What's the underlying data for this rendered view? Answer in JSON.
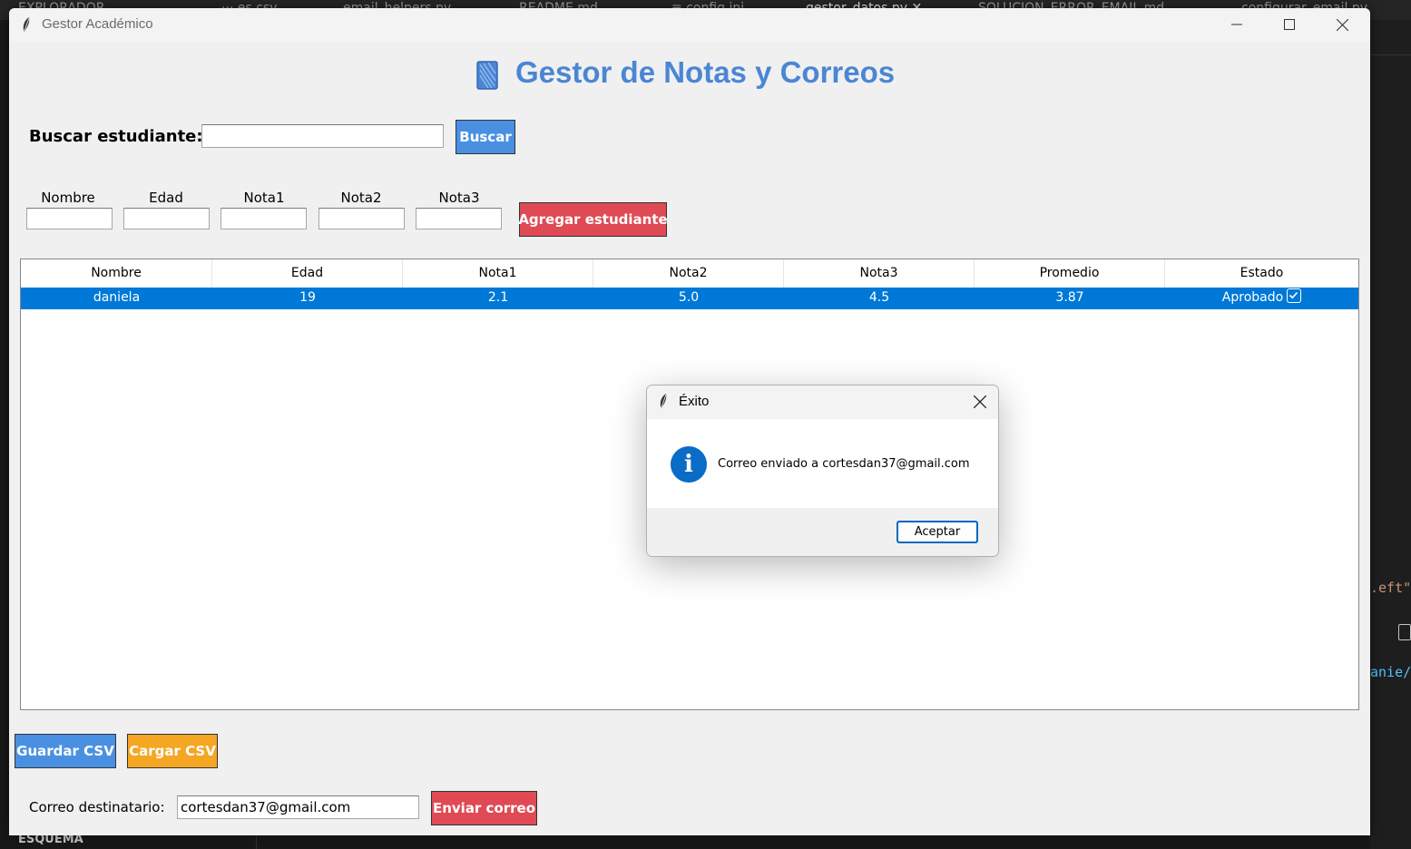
{
  "background_editor": {
    "tabs": [
      {
        "label": "EXPLORADOR",
        "active": false
      },
      {
        "label": "··· es.csv",
        "active": false
      },
      {
        "label": "email_helpers.py",
        "active": false
      },
      {
        "label": "README.md",
        "active": false
      },
      {
        "label": "≡ config.ini",
        "active": false
      },
      {
        "label": "gestor_datos.py ✕",
        "active": true
      },
      {
        "label": "SOLUCION_ERROR_EMAIL.md",
        "active": false
      },
      {
        "label": "configurar_email.py",
        "active": false
      }
    ],
    "code_fragments": [
      ".eft\",",
      "anie/D"
    ],
    "bottom_panel_label": "ESQUEMA"
  },
  "window": {
    "title": "Gestor Académico",
    "icon": "feather-icon"
  },
  "header": {
    "icon": "notebook-icon",
    "title": "Gestor de Notas y Correos"
  },
  "search": {
    "label": "Buscar estudiante:",
    "value": "",
    "button_label": "Buscar"
  },
  "form": {
    "labels": [
      "Nombre",
      "Edad",
      "Nota1",
      "Nota2",
      "Nota3"
    ],
    "add_button_label": "Agregar estudiante"
  },
  "table": {
    "columns": [
      "Nombre",
      "Edad",
      "Nota1",
      "Nota2",
      "Nota3",
      "Promedio",
      "Estado"
    ],
    "rows": [
      {
        "Nombre": "daniela",
        "Edad": "19",
        "Nota1": "2.1",
        "Nota2": "5.0",
        "Nota3": "4.5",
        "Promedio": "3.87",
        "Estado": "Aprobado",
        "selected": true
      }
    ]
  },
  "csv": {
    "save_label": "Guardar CSV",
    "load_label": "Cargar CSV"
  },
  "email": {
    "label": "Correo destinatario:",
    "value": "cortesdan37@gmail.com",
    "send_label": "Enviar correo"
  },
  "dialog": {
    "title": "Éxito",
    "icon": "info-icon",
    "icon_glyph": "i",
    "message": "Correo enviado a cortesdan37@gmail.com",
    "ok_label": "Aceptar"
  },
  "colors": {
    "title_blue": "#4a86d4",
    "button_blue": "#4a90e2",
    "button_red": "#e04a55",
    "button_orange": "#f5a623",
    "selection": "#0078d7",
    "info_icon": "#0a6cc7"
  }
}
